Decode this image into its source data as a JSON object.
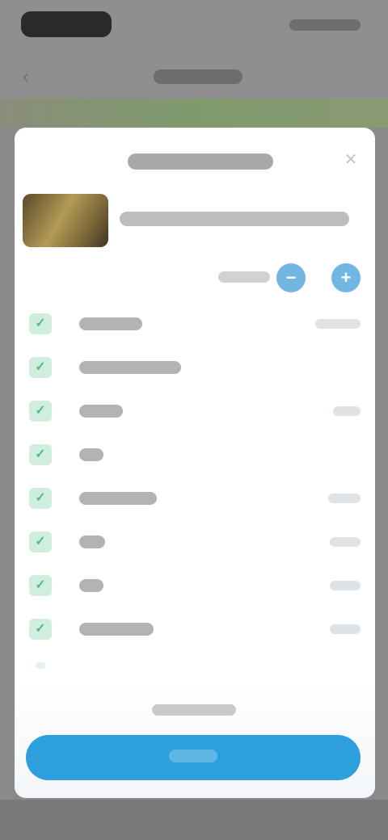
{
  "status_bar": {
    "time": "",
    "indicators": ""
  },
  "header": {
    "title": "",
    "back_icon": "back-arrow-icon",
    "action_icon": "more-icon"
  },
  "sheet": {
    "title": "",
    "close_icon": "close-icon",
    "product": {
      "name": "",
      "thumbnail_icon": "product-image"
    },
    "quantity": {
      "label": "",
      "value": ""
    },
    "options": [
      {
        "label": "",
        "price": ""
      },
      {
        "label": "",
        "price": ""
      },
      {
        "label": "",
        "price": ""
      },
      {
        "label": "",
        "price": ""
      },
      {
        "label": "",
        "price": ""
      },
      {
        "label": "",
        "price": ""
      },
      {
        "label": "",
        "price": ""
      },
      {
        "label": "",
        "price": ""
      }
    ],
    "summary": "",
    "confirm_label": ""
  },
  "colors": {
    "accent": "#2d9fdc",
    "check": "#58b98a",
    "overlay": "#8a8a8a"
  }
}
